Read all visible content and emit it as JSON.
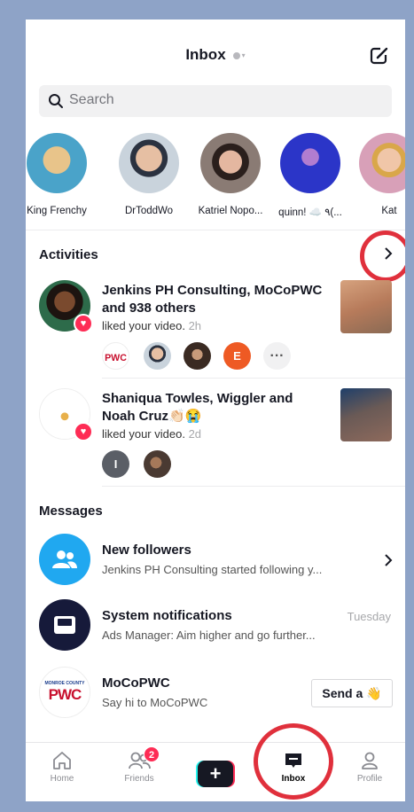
{
  "header": {
    "title": "Inbox",
    "compose_icon": "compose-icon"
  },
  "search": {
    "placeholder": "Search"
  },
  "stories": [
    {
      "name": "King Frenchy",
      "color": "#4aa3c9"
    },
    {
      "name": "DrToddWo",
      "color": "#c9d3dc"
    },
    {
      "name": "Katriel Nopo...",
      "color": "#5a4a44"
    },
    {
      "name": "quinn! ☁️ ٩(...",
      "color": "#2b35c8"
    },
    {
      "name": "Kat",
      "color": "#d8a0b8"
    }
  ],
  "activities": {
    "title": "Activities",
    "items": [
      {
        "who": "Jenkins PH Consulting, MoCoPWC and 938 others",
        "action": "liked your video.",
        "time": "2h",
        "extra_initial": "E"
      },
      {
        "who": "Shaniqua Towles, Wiggler and Noah Cruz👏🏻😭",
        "action": "liked your video.",
        "time": "2d",
        "extra_initial": "I"
      }
    ]
  },
  "messages": {
    "title": "Messages",
    "items": [
      {
        "name": "New followers",
        "sub": "Jenkins PH Consulting started following y...",
        "time": ""
      },
      {
        "name": "System notifications",
        "sub": "Ads Manager: Aim higher and go further...",
        "time": "Tuesday"
      },
      {
        "name": "MoCoPWC",
        "sub": "Say hi to MoCoPWC",
        "button": "Send a 👋"
      }
    ]
  },
  "logos": {
    "pwc": "PWC",
    "pwc_top": "MONROE COUNTY"
  },
  "tabbar": {
    "home": "Home",
    "friends": "Friends",
    "friends_badge": "2",
    "create": "+",
    "inbox": "Inbox",
    "profile": "Profile"
  },
  "colors": {
    "accent": "#fe2c55",
    "highlight_ring": "#e0303c",
    "frame": "#8ea3c7",
    "follower_blue": "#20a8f0",
    "system_navy": "#161a3a"
  }
}
